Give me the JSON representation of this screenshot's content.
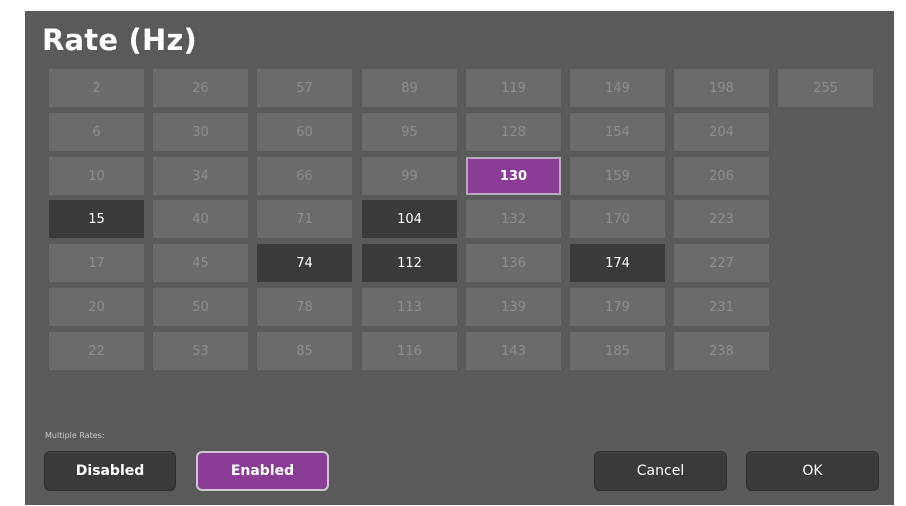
{
  "title": "Rate (Hz)",
  "selected_rate": "130",
  "columns": [
    [
      {
        "label": "2",
        "state": "normal"
      },
      {
        "label": "6",
        "state": "normal"
      },
      {
        "label": "10",
        "state": "normal"
      },
      {
        "label": "15",
        "state": "dark"
      },
      {
        "label": "17",
        "state": "normal"
      },
      {
        "label": "20",
        "state": "normal"
      },
      {
        "label": "22",
        "state": "normal"
      }
    ],
    [
      {
        "label": "26",
        "state": "normal"
      },
      {
        "label": "30",
        "state": "normal"
      },
      {
        "label": "34",
        "state": "normal"
      },
      {
        "label": "40",
        "state": "normal"
      },
      {
        "label": "45",
        "state": "normal"
      },
      {
        "label": "50",
        "state": "normal"
      },
      {
        "label": "53",
        "state": "normal"
      }
    ],
    [
      {
        "label": "57",
        "state": "normal"
      },
      {
        "label": "60",
        "state": "normal"
      },
      {
        "label": "66",
        "state": "normal"
      },
      {
        "label": "71",
        "state": "normal"
      },
      {
        "label": "74",
        "state": "dark"
      },
      {
        "label": "78",
        "state": "normal"
      },
      {
        "label": "85",
        "state": "normal"
      }
    ],
    [
      {
        "label": "89",
        "state": "normal"
      },
      {
        "label": "95",
        "state": "normal"
      },
      {
        "label": "99",
        "state": "normal"
      },
      {
        "label": "104",
        "state": "dark"
      },
      {
        "label": "112",
        "state": "dark"
      },
      {
        "label": "113",
        "state": "normal"
      },
      {
        "label": "116",
        "state": "normal"
      }
    ],
    [
      {
        "label": "119",
        "state": "normal"
      },
      {
        "label": "128",
        "state": "normal"
      },
      {
        "label": "130",
        "state": "selected"
      },
      {
        "label": "132",
        "state": "normal"
      },
      {
        "label": "136",
        "state": "normal"
      },
      {
        "label": "139",
        "state": "normal"
      },
      {
        "label": "143",
        "state": "normal"
      }
    ],
    [
      {
        "label": "149",
        "state": "normal"
      },
      {
        "label": "154",
        "state": "normal"
      },
      {
        "label": "159",
        "state": "normal"
      },
      {
        "label": "170",
        "state": "normal"
      },
      {
        "label": "174",
        "state": "dark"
      },
      {
        "label": "179",
        "state": "normal"
      },
      {
        "label": "185",
        "state": "normal"
      }
    ],
    [
      {
        "label": "198",
        "state": "normal"
      },
      {
        "label": "204",
        "state": "normal"
      },
      {
        "label": "206",
        "state": "normal"
      },
      {
        "label": "223",
        "state": "normal"
      },
      {
        "label": "227",
        "state": "normal"
      },
      {
        "label": "231",
        "state": "normal"
      },
      {
        "label": "238",
        "state": "normal"
      }
    ],
    [
      {
        "label": "255",
        "state": "normal"
      }
    ]
  ],
  "multiple_rates": {
    "label": "Multiple Rates:",
    "disabled_label": "Disabled",
    "enabled_label": "Enabled",
    "active": "Enabled"
  },
  "actions": {
    "cancel_label": "Cancel",
    "ok_label": "OK"
  },
  "colors": {
    "panel": "#5a5a5a",
    "button_normal": "#6b6b6b",
    "button_dark": "#3a3a3a",
    "accent_purple": "#8a3d94"
  }
}
